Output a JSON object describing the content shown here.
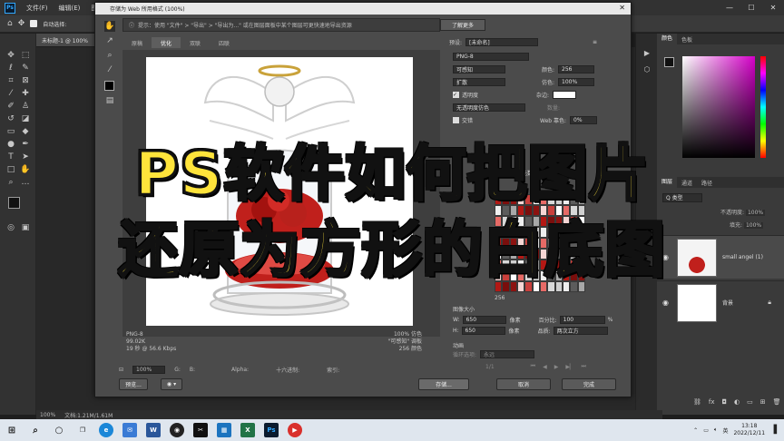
{
  "app": {
    "menu": [
      "文件(F)",
      "编辑(E)",
      "图像"
    ],
    "doc_tab": "未标题-1 @ 100%",
    "option_label": "自动选择:",
    "status": "文档:1.21M/1.61M",
    "status_zoom": "100%"
  },
  "dialog": {
    "title": "存储为 Web 所用格式 (100%)",
    "tip": "提示：使用 \"文件\" > \"导出\" > \"导出为...\" 或在图层面板中某个图层可更快速地导出资源",
    "tip_button": "了解更多",
    "tabs": [
      "原稿",
      "优化",
      "双联",
      "四联"
    ],
    "preview_info_left": [
      "PNG-8",
      "99.02K",
      "19 秒 @ 56.6 Kbps"
    ],
    "preview_info_right": [
      "100% 仿色",
      "\"可感知\" 调板",
      "256 颜色"
    ],
    "zoom": "100%",
    "readout_labels": [
      "G:",
      "B:",
      "Alpha:",
      "十六进制:",
      "索引:"
    ],
    "preview_button": "预览...",
    "save_button": "存储...",
    "cancel_button": "取消",
    "done_button": "完成",
    "settings": {
      "preset_label": "预设:",
      "preset_value": "[未命名]",
      "format": "PNG-8",
      "reduction": "可感知",
      "dither_algo": "扩散",
      "colors_label": "颜色:",
      "colors_value": "256",
      "dither_label": "仿色:",
      "dither_value": "100%",
      "transparency_label": "透明度",
      "matte_label": "杂边:",
      "transparency_dither": "无透明度仿色",
      "amount_label": "数量:",
      "interlaced_label": "交错",
      "websnap_label": "Web 靠色:",
      "websnap_value": "0%",
      "color_table_label": "颜色表",
      "metadata_label": "元数据",
      "palette_count": "256",
      "image_size_label": "图像大小",
      "w_label": "W:",
      "w_value": "650",
      "h_label": "H:",
      "h_value": "650",
      "px_unit": "像素",
      "percent_label": "百分比:",
      "percent_value": "100",
      "percent_unit": "%",
      "quality_label": "品质:",
      "quality_value": "两次立方",
      "animation_label": "动画",
      "loop_label": "循环选项:",
      "loop_value": "永远",
      "frame_count": "1/1"
    }
  },
  "panels": {
    "color_tabs": [
      "颜色",
      "色板"
    ],
    "layer_tabs": [
      "图层",
      "通道",
      "路径"
    ],
    "kind_label": "Q 类型",
    "opacity_label": "不透明度:",
    "opacity_value": "100%",
    "fill_label": "填充:",
    "fill_value": "100%",
    "layers": [
      {
        "name": "small angel (1)"
      },
      {
        "name": "背景"
      }
    ]
  },
  "caption": {
    "line1": "PS软件如何把图片",
    "line2": "还原为方形的白底图"
  },
  "taskbar": {
    "time": "13:18",
    "date": "2022/12/11",
    "ime": "英"
  },
  "colors": {
    "caption": "#ffe43b",
    "ps_blue": "#31a8ff",
    "accent_red": "#c0201c"
  }
}
